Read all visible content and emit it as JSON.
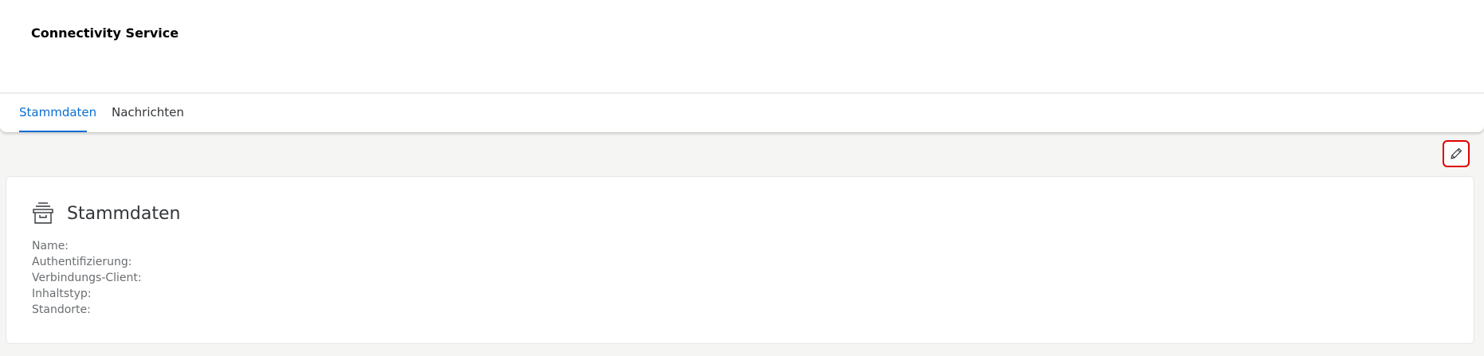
{
  "header": {
    "title": "Connectivity Service"
  },
  "tabs": [
    {
      "label": "Stammdaten",
      "active": true
    },
    {
      "label": "Nachrichten",
      "active": false
    }
  ],
  "toolbar": {
    "edit_icon": "pencil-icon"
  },
  "card": {
    "icon": "archive-box-icon",
    "title": "Stammdaten",
    "fields": [
      {
        "label": "Name:",
        "value": ""
      },
      {
        "label": "Authentifizierung:",
        "value": ""
      },
      {
        "label": "Verbindungs-Client:",
        "value": ""
      },
      {
        "label": "Inhaltstyp:",
        "value": ""
      },
      {
        "label": "Standorte:",
        "value": ""
      }
    ]
  },
  "colors": {
    "accent": "#0a6ed1",
    "highlight_border": "#e00000",
    "background": "#f5f5f4"
  }
}
